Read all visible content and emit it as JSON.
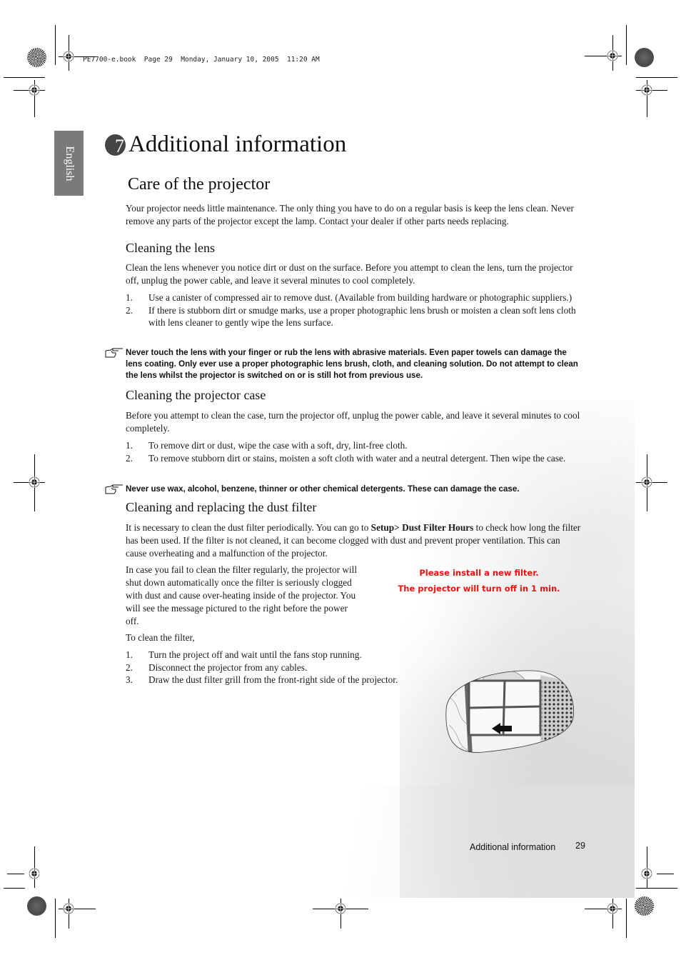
{
  "print_header": "PE7700-e.book  Page 29  Monday, January 10, 2005  11:20 AM",
  "language_tab": "English",
  "chapter": {
    "number": "7",
    "title": "Additional information"
  },
  "section": {
    "title": "Care of the projector",
    "intro": "Your projector needs little maintenance. The only thing you have to do on a regular basis is keep the lens clean. Never remove any parts of the projector except the lamp. Contact your dealer if other parts needs replacing."
  },
  "cleaning_lens": {
    "heading": "Cleaning the lens",
    "intro": "Clean the lens whenever you notice dirt or dust on the surface. Before you attempt to clean the lens, turn the projector off, unplug the power cable, and leave it several minutes to cool completely.",
    "steps": [
      {
        "num": "1.",
        "text": "Use a canister of compressed air to remove dust. (Available from building hardware or photographic suppliers.)"
      },
      {
        "num": "2.",
        "text": "If there is stubborn dirt or smudge marks, use a proper photographic lens brush or moisten a clean soft lens cloth with lens cleaner to gently wipe the lens surface."
      }
    ],
    "note": "Never touch the lens with your finger or rub the lens with abrasive materials. Even paper towels can damage the lens coating. Only ever use a proper photographic lens brush, cloth, and cleaning solution. Do not attempt to clean the lens whilst the projector is switched on or is still hot from previous use."
  },
  "cleaning_case": {
    "heading": "Cleaning the projector case",
    "intro": "Before you attempt to clean the case, turn the projector off, unplug the power cable, and leave it several minutes to cool completely.",
    "steps": [
      {
        "num": "1.",
        "text": "To remove dirt or dust, wipe the case with a soft, dry, lint-free cloth."
      },
      {
        "num": "2.",
        "text": "To remove stubborn dirt or stains, moisten a soft cloth with water and a neutral detergent. Then wipe the case."
      }
    ],
    "note": "Never use wax, alcohol, benzene, thinner or other chemical detergents. These can damage the case."
  },
  "dust_filter": {
    "heading": "Cleaning and replacing the dust filter",
    "intro_before": "It is necessary to clean the dust filter periodically. You can go to ",
    "setup_path": "Setup> Dust Filter Hours",
    "intro_after": " to check how long the filter has been used. If the filter is not cleaned, it can become clogged with dust and prevent proper ventilation. This can cause overheating and a malfunction of the projector.",
    "warning_para": "In case you fail to clean the filter regularly, the projector will shut down automatically once the filter is seriously clogged with dust and cause over-heating inside of the projector. You will see the message pictured to the right before the power off.",
    "osd_messages": [
      "Please install a new filter.",
      "The projector will turn off in 1 min."
    ],
    "osd_color": "#f01010",
    "to_clean": "To clean the filter,",
    "steps": [
      {
        "num": "1.",
        "text": "Turn the project off and wait until the fans stop running."
      },
      {
        "num": "2.",
        "text": "Disconnect the projector from any cables."
      },
      {
        "num": "3.",
        "text": "Draw the dust filter grill from the front-right side of the projector."
      }
    ]
  },
  "footer": {
    "title": "Additional information",
    "page": "29"
  }
}
